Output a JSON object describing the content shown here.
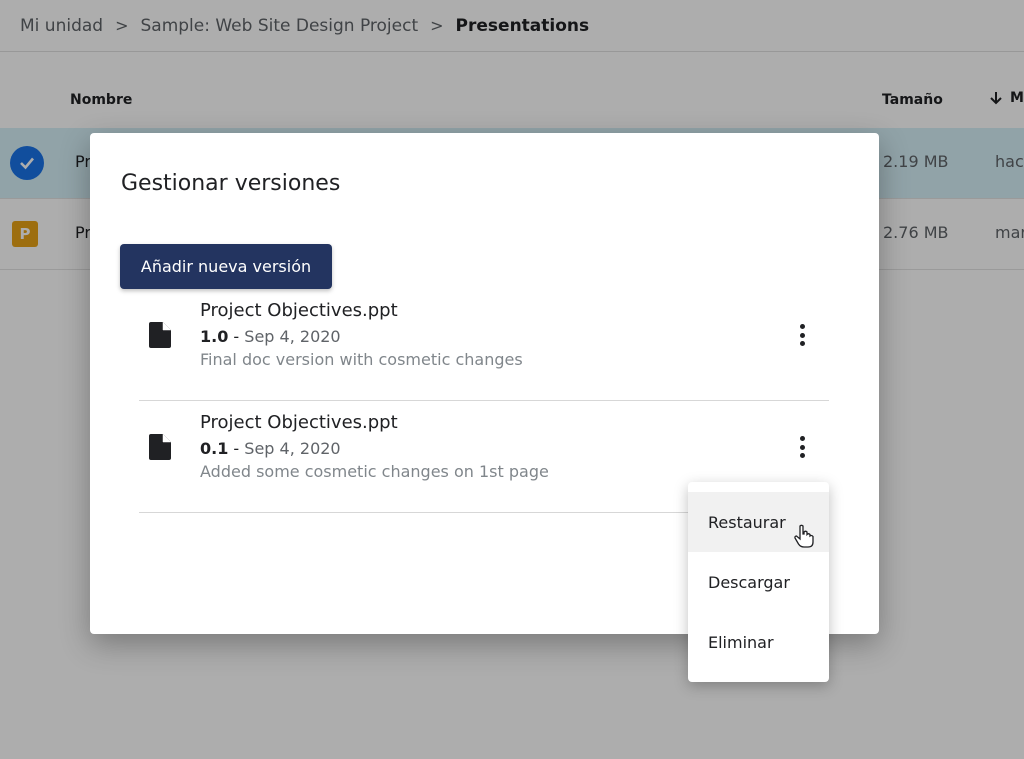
{
  "breadcrumb": {
    "items": [
      "Mi unidad",
      "Sample: Web Site Design Project",
      "Presentations"
    ],
    "separator": ">"
  },
  "list": {
    "headers": {
      "name": "Nombre",
      "size": "Tamaño",
      "modified": "M"
    },
    "rows": [
      {
        "name": "Pr",
        "size": "2.19 MB",
        "modified": "hac",
        "selected": true,
        "icon": "check-circle-icon"
      },
      {
        "name": "Pr",
        "size": "2.76 MB",
        "modified": "mar",
        "selected": false,
        "icon": "powerpoint-icon",
        "icon_letter": "P"
      }
    ]
  },
  "dialog": {
    "title": "Gestionar versiones",
    "add_button_label": "Añadir nueva versión",
    "versions": [
      {
        "filename": "Project Objectives.ppt",
        "version": "1.0",
        "separator": " - ",
        "date": "Sep 4, 2020",
        "description": "Final doc version with cosmetic changes"
      },
      {
        "filename": "Project Objectives.ppt",
        "version": "0.1",
        "separator": " - ",
        "date": "Sep 4, 2020",
        "description": "Added some cosmetic changes on 1st page"
      }
    ]
  },
  "context_menu": {
    "items": [
      "Restaurar",
      "Descargar",
      "Eliminar"
    ],
    "hovered_index": 0
  },
  "colors": {
    "primary_button": "#233460",
    "selected_row": "#d6f0f8",
    "check_blue": "#1a73e8",
    "ppt_orange": "#e8a317"
  }
}
